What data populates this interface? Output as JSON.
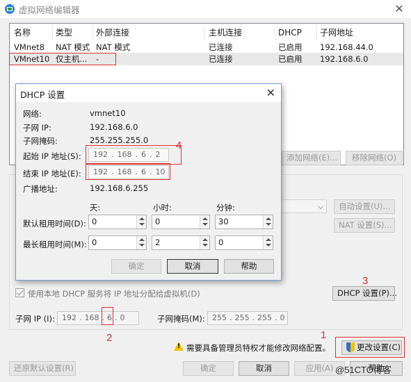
{
  "window": {
    "title": "虚拟网络编辑器",
    "close_glyph": "✕"
  },
  "table": {
    "headers": [
      "名称",
      "类型",
      "外部连接",
      "主机连接",
      "DHCP",
      "子网地址"
    ],
    "rows": [
      [
        "VMnet8",
        "NAT 模式",
        "NAT 模式",
        "已连接",
        "已启用",
        "192.168.44.0"
      ],
      [
        "VMnet10",
        "仅主机...",
        "-",
        "已连接",
        "已启用",
        "192.168.6.0"
      ]
    ]
  },
  "buttons": {
    "add_network": "添加网络(E)...",
    "remove_network": "移除网络(O)",
    "auto_settings": "自动设置(U)...",
    "nat_settings": "NAT 设置(S)...",
    "dhcp_settings": "DHCP 设置(P)...",
    "change_settings": "更改设置(C)",
    "restore_defaults": "还原默认设置(R)",
    "ok": "确定",
    "cancel": "取消",
    "apply": "应用(A)",
    "help": "帮助"
  },
  "vmnet_info": {
    "dhcp_checkbox": "使用本地 DHCP 服务将 IP 地址分配给虚拟机(D)",
    "subnet_ip_label": "子网 IP (I):",
    "subnet_ip": [
      "192",
      "168",
      "6",
      "0"
    ],
    "subnet_mask_label": "子网掩码(M):",
    "subnet_mask": [
      "255",
      "255",
      "255",
      "0"
    ],
    "admin_warning": "需要具备管理员特权才能修改网络配置。"
  },
  "dhcp_dialog": {
    "title": "DHCP 设置",
    "close_glyph": "✕",
    "network_label": "网络:",
    "network_value": "vmnet10",
    "subnet_ip_label": "子网 IP:",
    "subnet_ip_value": "192.168.6.0",
    "mask_label": "子网掩码:",
    "mask_value": "255.255.255.0",
    "start_ip_label": "起始 IP 地址(S):",
    "start_ip": [
      "192",
      "168",
      "6",
      "2"
    ],
    "end_ip_label": "结束 IP 地址(E):",
    "end_ip": [
      "192",
      "168",
      "6",
      "10"
    ],
    "broadcast_label": "广播地址:",
    "broadcast_value": "192.168.6.255",
    "col_days": "天:",
    "col_hours": "小时:",
    "col_minutes": "分钟:",
    "default_lease_label": "默认租用时间(D):",
    "default_lease": [
      "0",
      "0",
      "30"
    ],
    "max_lease_label": "最长租用时间(M):",
    "max_lease": [
      "0",
      "2",
      "0"
    ],
    "ok": "确定",
    "cancel": "取消",
    "help": "帮助"
  },
  "annotations": {
    "n1": "1",
    "n2": "2",
    "n3": "3",
    "n4": "4",
    "color": "#e03030"
  },
  "watermark": "@51CTO博客"
}
